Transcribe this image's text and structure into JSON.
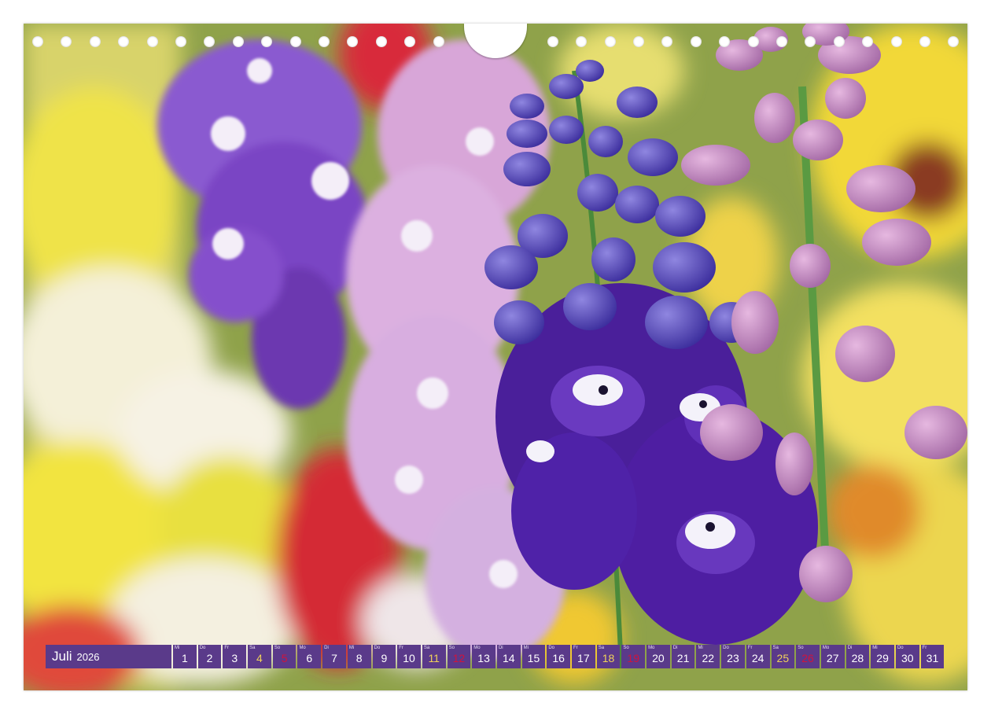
{
  "calendar": {
    "month": "Juli",
    "year": "2026",
    "days": [
      {
        "num": "1",
        "dow": "Mi",
        "type": "weekday"
      },
      {
        "num": "2",
        "dow": "Do",
        "type": "weekday"
      },
      {
        "num": "3",
        "dow": "Fr",
        "type": "weekday"
      },
      {
        "num": "4",
        "dow": "Sa",
        "type": "sat"
      },
      {
        "num": "5",
        "dow": "So",
        "type": "sun"
      },
      {
        "num": "6",
        "dow": "Mo",
        "type": "weekday"
      },
      {
        "num": "7",
        "dow": "Di",
        "type": "weekday"
      },
      {
        "num": "8",
        "dow": "Mi",
        "type": "weekday"
      },
      {
        "num": "9",
        "dow": "Do",
        "type": "weekday"
      },
      {
        "num": "10",
        "dow": "Fr",
        "type": "weekday"
      },
      {
        "num": "11",
        "dow": "Sa",
        "type": "sat"
      },
      {
        "num": "12",
        "dow": "So",
        "type": "sun"
      },
      {
        "num": "13",
        "dow": "Mo",
        "type": "weekday"
      },
      {
        "num": "14",
        "dow": "Di",
        "type": "weekday"
      },
      {
        "num": "15",
        "dow": "Mi",
        "type": "weekday"
      },
      {
        "num": "16",
        "dow": "Do",
        "type": "weekday"
      },
      {
        "num": "17",
        "dow": "Fr",
        "type": "weekday"
      },
      {
        "num": "18",
        "dow": "Sa",
        "type": "sat"
      },
      {
        "num": "19",
        "dow": "So",
        "type": "sun"
      },
      {
        "num": "20",
        "dow": "Mo",
        "type": "weekday"
      },
      {
        "num": "21",
        "dow": "Di",
        "type": "weekday"
      },
      {
        "num": "22",
        "dow": "Mi",
        "type": "weekday"
      },
      {
        "num": "23",
        "dow": "Do",
        "type": "weekday"
      },
      {
        "num": "24",
        "dow": "Fr",
        "type": "weekday"
      },
      {
        "num": "25",
        "dow": "Sa",
        "type": "sat"
      },
      {
        "num": "26",
        "dow": "So",
        "type": "sun"
      },
      {
        "num": "27",
        "dow": "Mo",
        "type": "weekday"
      },
      {
        "num": "28",
        "dow": "Di",
        "type": "weekday"
      },
      {
        "num": "29",
        "dow": "Mi",
        "type": "weekday"
      },
      {
        "num": "30",
        "dow": "Do",
        "type": "weekday"
      },
      {
        "num": "31",
        "dow": "Fr",
        "type": "weekday"
      }
    ]
  },
  "colors": {
    "bar": "#5a3a8a",
    "weekend_sat": "#f0d25a",
    "weekend_sun": "#d0143c"
  },
  "photo": {
    "subject_icon": "delphinium-flowers-icon"
  }
}
